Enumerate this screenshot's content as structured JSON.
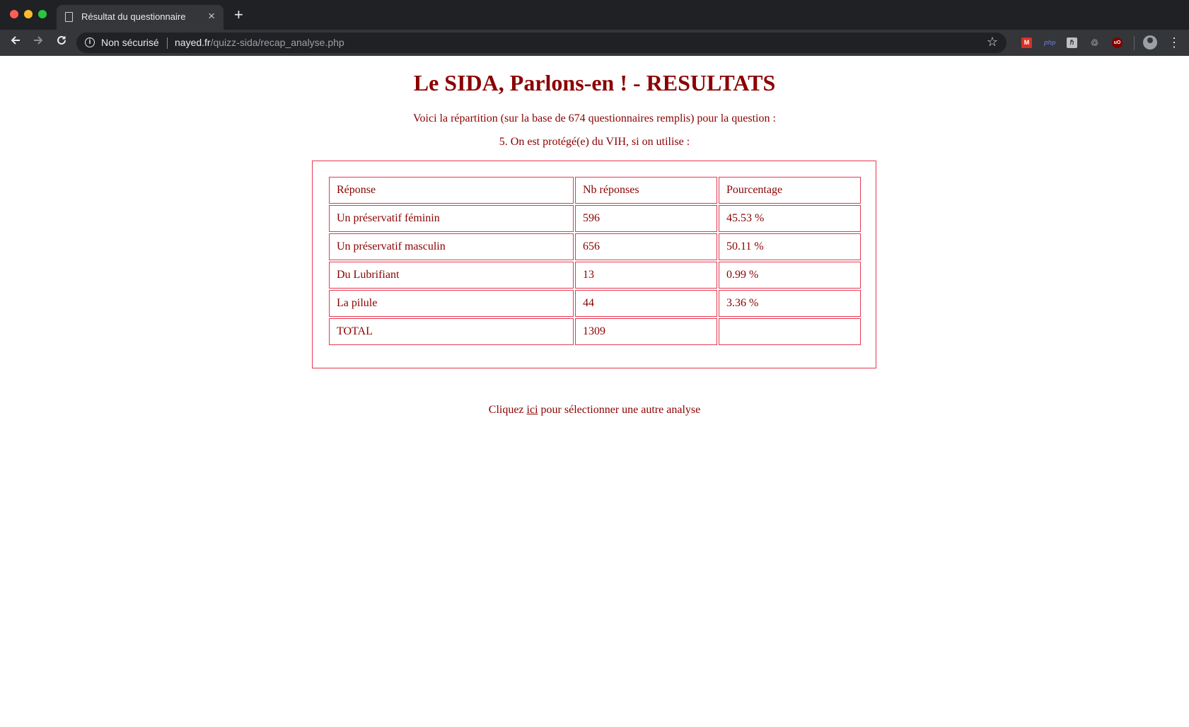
{
  "browser": {
    "tab_title": "Résultat du questionnaire",
    "tab_close": "×",
    "new_tab": "+",
    "security_label": "Non sécurisé",
    "url_host": "nayed.fr",
    "url_path": "/quizz-sida/recap_analyse.php",
    "extensions": [
      "gmail-icon",
      "php-icon",
      "h-extension-icon",
      "recycle-icon",
      "ublock-icon"
    ],
    "colors": {
      "tabbar": "#202124",
      "toolbar": "#35363a"
    }
  },
  "page": {
    "title": "Le SIDA, Parlons-en ! - RESULTATS",
    "intro": "Voici la répartition (sur la base de 674 questionnaires remplis) pour la question :",
    "question": "5. On est protégé(e) du VIH, si on utilise :",
    "table": {
      "headers": [
        "Réponse",
        "Nb réponses",
        "Pourcentage"
      ],
      "rows": [
        [
          "Un préservatif féminin",
          "596",
          "45.53 %"
        ],
        [
          "Un préservatif masculin",
          "656",
          "50.11 %"
        ],
        [
          "Du Lubrifiant",
          "13",
          "0.99 %"
        ],
        [
          "La pilule",
          "44",
          "3.36 %"
        ],
        [
          "TOTAL",
          "1309",
          ""
        ]
      ]
    },
    "footer": {
      "before": "Cliquez ",
      "link": "ici",
      "after": " pour sélectionner une autre analyse"
    },
    "colors": {
      "text": "#8b0000",
      "border": "#e53950"
    }
  }
}
